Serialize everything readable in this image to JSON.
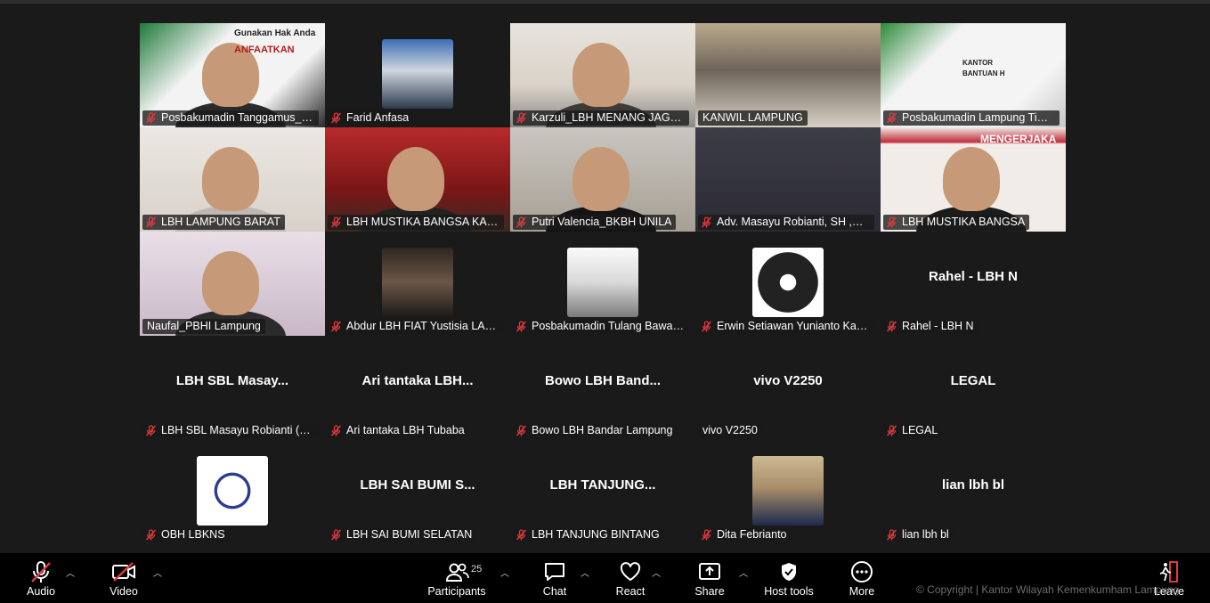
{
  "colors": {
    "background": "#1a1a1a",
    "active_speaker": "#23d959",
    "mute": "#e0393e"
  },
  "tiles": [
    {
      "name": "Posbakumadin Tanggamus_A...",
      "muted": true,
      "kind": "video",
      "overlay_text": [
        "Gunakan Hak Anda",
        "ANFAATKAN"
      ]
    },
    {
      "name": "Farid Anfasa",
      "muted": true,
      "kind": "thumb"
    },
    {
      "name": "Karzuli_LBH MENANG JAGAD",
      "muted": true,
      "kind": "video"
    },
    {
      "name": "KANWIL LAMPUNG",
      "muted": false,
      "kind": "video",
      "active": true
    },
    {
      "name": "Posbakumadin Lampung Tim...",
      "muted": true,
      "kind": "video",
      "overlay_text": [
        "KANTOR",
        "BANTUAN H"
      ]
    },
    {
      "name": "LBH LAMPUNG BARAT",
      "muted": true,
      "kind": "video"
    },
    {
      "name": "LBH MUSTIKA BANGSA KAN...",
      "muted": true,
      "kind": "video"
    },
    {
      "name": "Putri Valencia_BKBH UNILA",
      "muted": true,
      "kind": "video"
    },
    {
      "name": "Adv. Masayu Robianti, SH ,M...",
      "muted": true,
      "kind": "video"
    },
    {
      "name": "LBH MUSTIKA BANGSA",
      "muted": true,
      "kind": "video",
      "overlay_text": [
        "MENGERJAKA"
      ]
    },
    {
      "name": "Naufal_PBHI Lampung",
      "muted": false,
      "kind": "video"
    },
    {
      "name": "Abdur LBH FIAT Yustisia LAMP...",
      "muted": true,
      "kind": "thumb"
    },
    {
      "name": "Posbakumadin Tulang Bawan...",
      "muted": true,
      "kind": "thumb"
    },
    {
      "name": "Erwin Setiawan Yunianto Kan...",
      "muted": true,
      "kind": "thumb"
    },
    {
      "name": "Rahel - LBH N",
      "muted": true,
      "kind": "text",
      "display": "Rahel - LBH N"
    },
    {
      "name": "LBH SBL Masayu Robianti (Ad...",
      "muted": true,
      "kind": "text",
      "display": "LBH SBL Masay..."
    },
    {
      "name": "Ari tantaka LBH Tubaba",
      "muted": true,
      "kind": "text",
      "display": "Ari tantaka LBH..."
    },
    {
      "name": "Bowo LBH Bandar Lampung",
      "muted": true,
      "kind": "text",
      "display": "Bowo LBH Band..."
    },
    {
      "name": "vivo V2250",
      "muted": false,
      "kind": "text",
      "display": "vivo V2250"
    },
    {
      "name": "LEGAL",
      "muted": true,
      "kind": "text",
      "display": "LEGAL"
    },
    {
      "name": "OBH LBKNS",
      "muted": true,
      "kind": "thumb"
    },
    {
      "name": "LBH SAI BUMI SELATAN",
      "muted": true,
      "kind": "text",
      "display": "LBH SAI BUMI S..."
    },
    {
      "name": "LBH TANJUNG BINTANG",
      "muted": true,
      "kind": "text",
      "display": "LBH TANJUNG..."
    },
    {
      "name": "Dita Febrianto",
      "muted": true,
      "kind": "thumb"
    },
    {
      "name": "lian lbh bl",
      "muted": true,
      "kind": "text",
      "display": "lian lbh bl"
    }
  ],
  "toolbar": {
    "audio": "Audio",
    "video": "Video",
    "participants": "Participants",
    "participants_count": "25",
    "chat": "Chat",
    "react": "React",
    "share": "Share",
    "host_tools": "Host tools",
    "more": "More",
    "leave": "Leave"
  },
  "watermark": "© Copyright | Kantor Wilayah Kemenkumham Lampung"
}
